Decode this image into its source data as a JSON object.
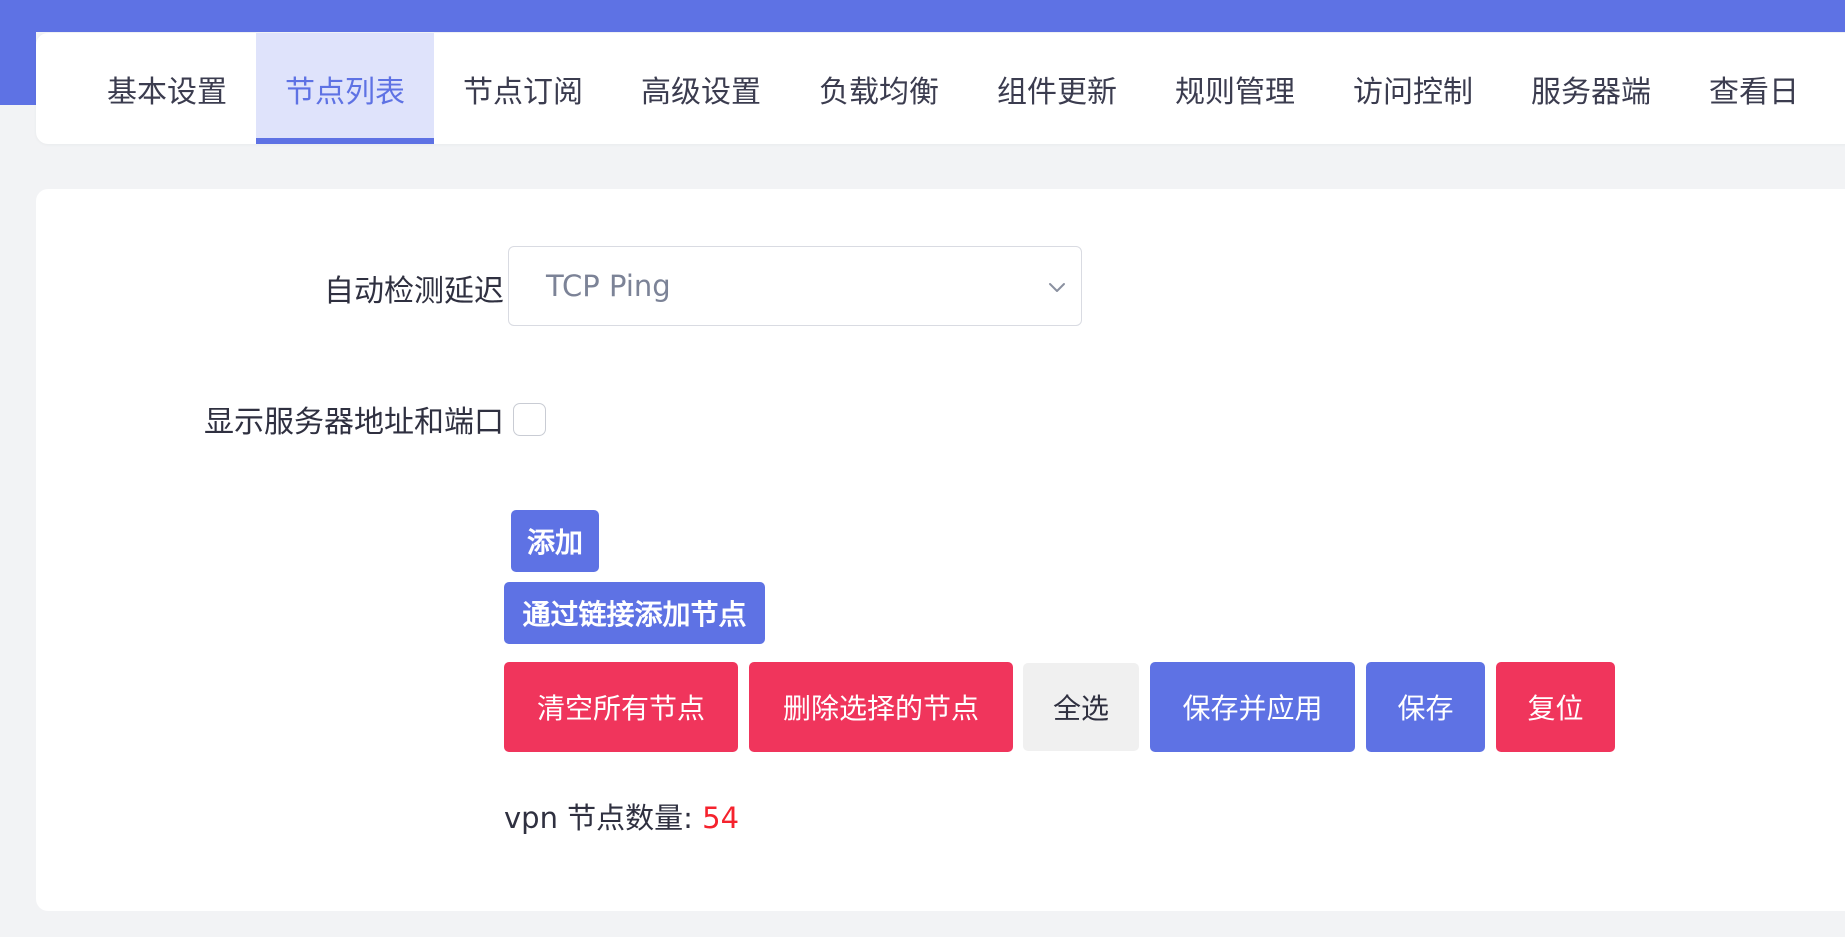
{
  "tabs": [
    {
      "label": "基本设置"
    },
    {
      "label": "节点列表",
      "active": true
    },
    {
      "label": "节点订阅"
    },
    {
      "label": "高级设置"
    },
    {
      "label": "负载均衡"
    },
    {
      "label": "组件更新"
    },
    {
      "label": "规则管理"
    },
    {
      "label": "访问控制"
    },
    {
      "label": "服务器端"
    },
    {
      "label": "查看日"
    }
  ],
  "form": {
    "latency_label": "自动检测延迟",
    "latency_value": "TCP Ping",
    "show_server_label": "显示服务器地址和端口",
    "show_server_checked": false
  },
  "buttons": {
    "add": "添加",
    "add_by_link": "通过链接添加节点",
    "clear_all": "清空所有节点",
    "delete_selected": "删除选择的节点",
    "select_all": "全选",
    "save_apply": "保存并应用",
    "save": "保存",
    "reset": "复位"
  },
  "node_count": {
    "label": "vpn 节点数量: ",
    "value": "54"
  },
  "colors": {
    "accent": "#5e72e4",
    "danger": "#f0355c",
    "count_value": "#f5222d"
  },
  "icons": {
    "select_chevron": "chevron-down-icon"
  }
}
